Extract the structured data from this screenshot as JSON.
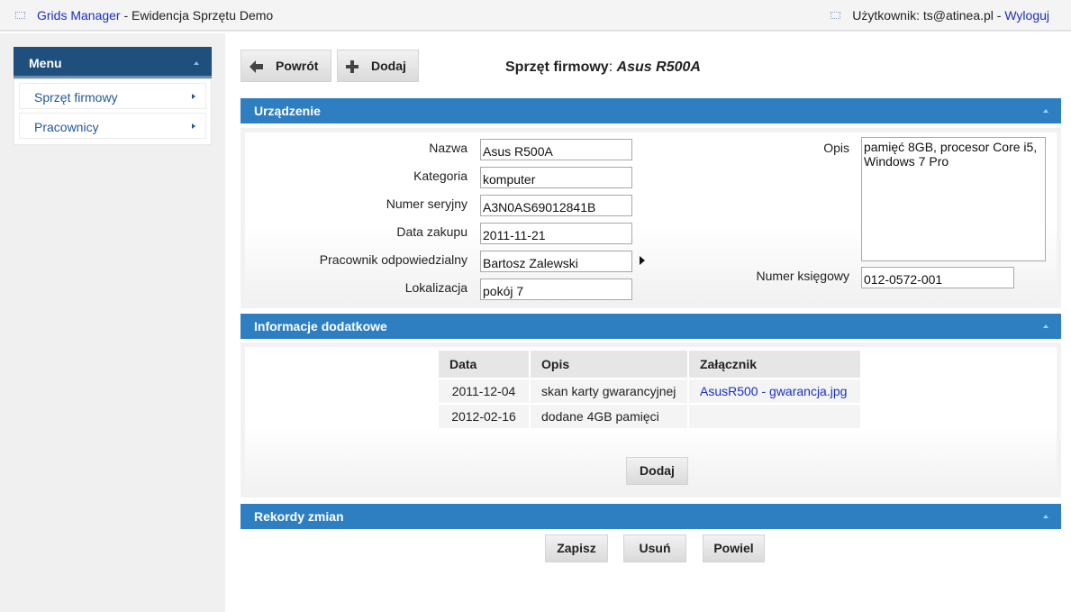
{
  "topbar": {
    "app_name": "Grids Manager",
    "app_subtitle": " - Ewidencja Sprzętu Demo",
    "user_label": "Użytkownik: ts@atinea.pl - ",
    "logout": "Wyloguj"
  },
  "sidebar": {
    "menu_title": "Menu",
    "items": [
      {
        "label": "Sprzęt firmowy"
      },
      {
        "label": "Pracownicy"
      }
    ]
  },
  "toolbar": {
    "back_label": "Powrót",
    "add_label": "Dodaj"
  },
  "page": {
    "title_prefix": "Sprzęt firmowy",
    "title_sep": ": ",
    "title_item": "Asus R500A"
  },
  "device_section": {
    "title": "Urządzenie",
    "fields": {
      "name": {
        "label": "Nazwa",
        "value": "Asus R500A"
      },
      "category": {
        "label": "Kategoria",
        "value": "komputer"
      },
      "serial": {
        "label": "Numer seryjny",
        "value": "A3N0AS69012841B"
      },
      "purchase_date": {
        "label": "Data zakupu",
        "value": "2011-11-21"
      },
      "employee": {
        "label": "Pracownik odpowiedzialny",
        "value": "Bartosz Zalewski"
      },
      "location": {
        "label": "Lokalizacja",
        "value": "pokój 7"
      },
      "description": {
        "label": "Opis",
        "value": "pamięć 8GB, procesor Core i5, Windows 7 Pro"
      },
      "account_number": {
        "label": "Numer księgowy",
        "value": "012-0572-001"
      }
    }
  },
  "extra_section": {
    "title": "Informacje dodatkowe",
    "columns": [
      "Data",
      "Opis",
      "Załącznik"
    ],
    "rows": [
      {
        "date": "2011-12-04",
        "desc": "skan karty gwarancyjnej",
        "attachment": "AsusR500 - gwarancja.jpg"
      },
      {
        "date": "2012-02-16",
        "desc": "dodane 4GB pamięci",
        "attachment": ""
      }
    ],
    "add_label": "Dodaj"
  },
  "records_section": {
    "title": "Rekordy zmian"
  },
  "actions": {
    "save": "Zapisz",
    "delete": "Usuń",
    "duplicate": "Powiel"
  },
  "colors": {
    "section_header": "#2e7fc2",
    "menu_header": "#1f4f7c",
    "link": "#1a2fc4"
  }
}
